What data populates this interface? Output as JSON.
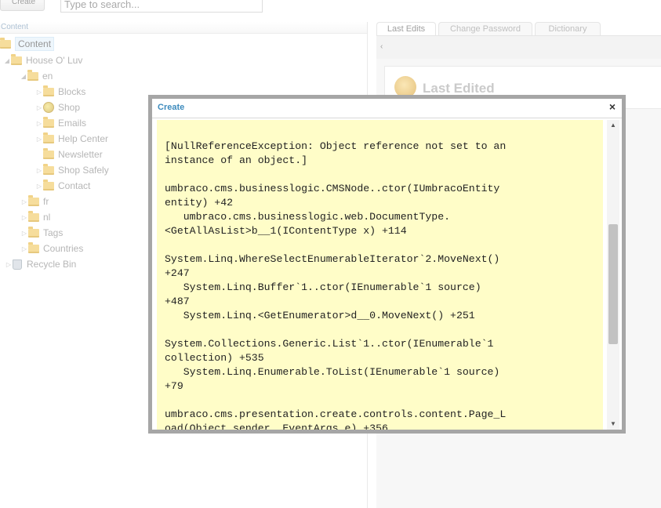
{
  "toolbar": {
    "create_label": "Create",
    "search_placeholder": "Type to search..."
  },
  "left_panel": {
    "header": "Content",
    "tree": [
      {
        "label": "Content",
        "icon": "folder-icon",
        "selected": true
      },
      {
        "label": "House O' Luv",
        "icon": "folder-icon"
      },
      {
        "label": "en",
        "icon": "folder-icon"
      },
      {
        "label": "Blocks",
        "icon": "folder-icon"
      },
      {
        "label": "Shop",
        "icon": "globe-icon"
      },
      {
        "label": "Emails",
        "icon": "folder-icon"
      },
      {
        "label": "Help Center",
        "icon": "folder-icon"
      },
      {
        "label": "Newsletter",
        "icon": "folder-icon"
      },
      {
        "label": "Shop Safely",
        "icon": "folder-icon"
      },
      {
        "label": "Contact",
        "icon": "folder-icon"
      },
      {
        "label": "fr",
        "icon": "folder-icon"
      },
      {
        "label": "nl",
        "icon": "folder-icon"
      },
      {
        "label": "Tags",
        "icon": "folder-icon"
      },
      {
        "label": "Countries",
        "icon": "folder-icon"
      },
      {
        "label": "Recycle Bin",
        "icon": "recycle-bin-icon"
      }
    ]
  },
  "right_panel": {
    "tabs": [
      "Last Edits",
      "Change Password",
      "Dictionary"
    ],
    "active_tab": "Last Edits",
    "dashboard_title": "Last Edited"
  },
  "modal": {
    "title": "Create",
    "close": "×",
    "error_text": "[NullReferenceException: Object reference not set to an\ninstance of an object.]\n\numbraco.cms.businesslogic.CMSNode..ctor(IUmbracoEntity\nentity) +42\n   umbraco.cms.businesslogic.web.DocumentType.\n<GetAllAsList>b__1(IContentType x) +114\n\nSystem.Linq.WhereSelectEnumerableIterator`2.MoveNext()\n+247\n   System.Linq.Buffer`1..ctor(IEnumerable`1 source)\n+487\n   System.Linq.<GetEnumerator>d__0.MoveNext() +251\n\nSystem.Collections.Generic.List`1..ctor(IEnumerable`1\ncollection) +535\n   System.Linq.Enumerable.ToList(IEnumerable`1 source)\n+79\n\numbraco.cms.presentation.create.controls.content.Page_L\noad(Object sender, EventArgs e) +356"
  },
  "colors": {
    "modal_body_bg": "#fffdc8",
    "modal_title": "#3d8bbd",
    "folder": "#f0c860"
  }
}
